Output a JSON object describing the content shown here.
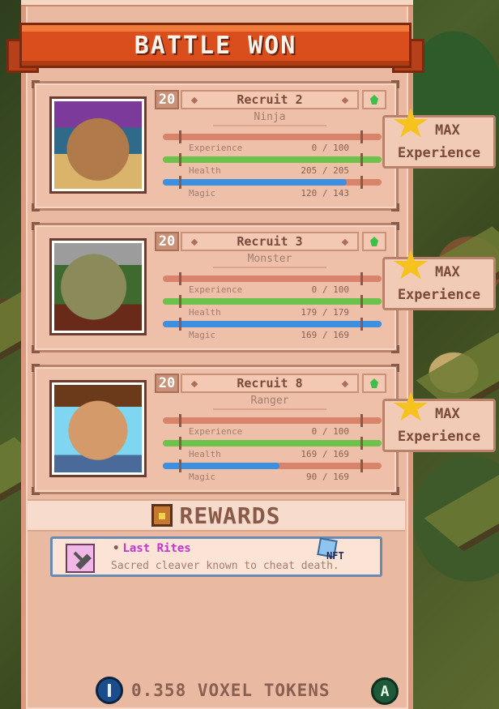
{
  "banner": {
    "title": "BATTLE WON"
  },
  "recruits": [
    {
      "level": "20",
      "name": "Recruit 2",
      "class": "Ninja",
      "stats": [
        {
          "label": "Experience",
          "value": "0 / 100",
          "fraction": 0.0,
          "color": "#d9846a"
        },
        {
          "label": "Health",
          "value": "205 / 205",
          "fraction": 1.0,
          "color": "#6cc24a"
        },
        {
          "label": "Magic",
          "value": "120 / 143",
          "fraction": 0.839,
          "color": "#3d8fe0"
        }
      ],
      "badge": {
        "max": "MAX",
        "label": "Experience"
      }
    },
    {
      "level": "20",
      "name": "Recruit 3",
      "class": "Monster",
      "stats": [
        {
          "label": "Experience",
          "value": "0 / 100",
          "fraction": 0.0,
          "color": "#d9846a"
        },
        {
          "label": "Health",
          "value": "179 / 179",
          "fraction": 1.0,
          "color": "#6cc24a"
        },
        {
          "label": "Magic",
          "value": "169 / 169",
          "fraction": 1.0,
          "color": "#3d8fe0"
        }
      ],
      "badge": {
        "max": "MAX",
        "label": "Experience"
      }
    },
    {
      "level": "20",
      "name": "Recruit 8",
      "class": "Ranger",
      "stats": [
        {
          "label": "Experience",
          "value": "0 / 100",
          "fraction": 0.0,
          "color": "#d9846a"
        },
        {
          "label": "Health",
          "value": "169 / 169",
          "fraction": 1.0,
          "color": "#6cc24a"
        },
        {
          "label": "Magic",
          "value": "90 / 169",
          "fraction": 0.533,
          "color": "#3d8fe0"
        }
      ],
      "badge": {
        "max": "MAX",
        "label": "Experience"
      }
    }
  ],
  "rewards": {
    "title": "REWARDS",
    "item": {
      "name": "Last Rites",
      "description": "Sacred cleaver known to cheat death.",
      "nft_label": "NFT"
    }
  },
  "tokens": {
    "amount": "0.358 VOXEL TOKENS"
  },
  "controller": {
    "button": "A"
  }
}
